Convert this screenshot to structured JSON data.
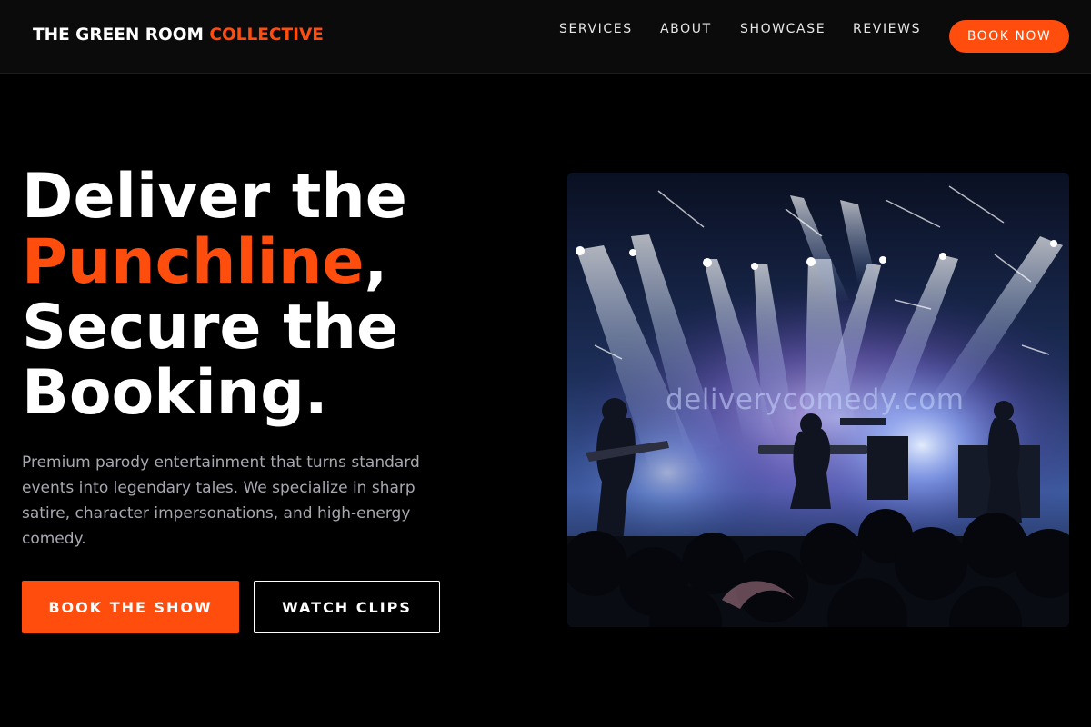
{
  "header": {
    "brand_main": "THE GREEN ROOM",
    "brand_accent": "COLLECTIVE",
    "nav": [
      "SERVICES",
      "ABOUT",
      "SHOWCASE",
      "REVIEWS"
    ],
    "cta_label": "BOOK NOW"
  },
  "hero": {
    "headline": {
      "line1": "Deliver the",
      "line2_accent": "Punchline",
      "line2_rest": ",",
      "line3": "Secure the",
      "line4": "Booking."
    },
    "description": "Premium parody entertainment that turns standard events into legendary tales. We specialize in sharp satire, character impersonations, and high-energy comedy.",
    "primary_button": "BOOK THE SHOW",
    "secondary_button": "WATCH CLIPS",
    "image_watermark": "deliverycomedy.com"
  },
  "colors": {
    "accent": "#ff4d0d",
    "background": "#000000",
    "header_background": "#0b0b0b",
    "muted_text": "#a7a8b0"
  }
}
